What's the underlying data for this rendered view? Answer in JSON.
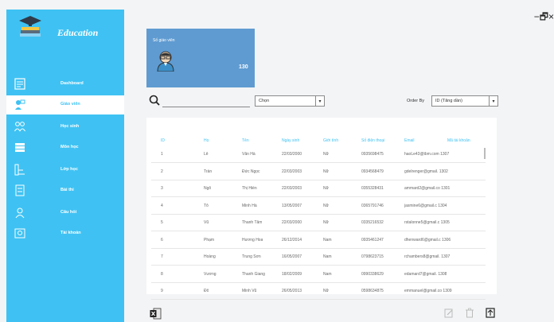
{
  "app": {
    "title": "Education"
  },
  "window_controls": {
    "label": "−🗗×"
  },
  "sidebar": {
    "items": [
      {
        "label": "Dashboard",
        "icon": "dashboard-icon",
        "active": false
      },
      {
        "label": "Giáo viên",
        "icon": "teacher-icon",
        "active": true
      },
      {
        "label": "Học sinh",
        "icon": "students-icon",
        "active": false
      },
      {
        "label": "Môn học",
        "icon": "subjects-icon",
        "active": false
      },
      {
        "label": "Lớp học",
        "icon": "classes-icon",
        "active": false
      },
      {
        "label": "Bài thi",
        "icon": "exam-icon",
        "active": false
      },
      {
        "label": "Câu hỏi",
        "icon": "questions-icon",
        "active": false
      },
      {
        "label": "Tài khoản",
        "icon": "account-icon",
        "active": false
      }
    ]
  },
  "summary": {
    "label": "Số giáo viên",
    "count": "130"
  },
  "search": {
    "value": "",
    "filter_value": "Chọn"
  },
  "order": {
    "label": "Order By",
    "value": "ID (Tăng dần)"
  },
  "table": {
    "columns": [
      "ID",
      "Họ",
      "Tên",
      "Ngày sinh",
      "Giới tính",
      "Số điện thoại",
      "Email",
      "Mã tài khoản"
    ],
    "rows": [
      [
        "1",
        "Lê",
        "Văn Hà",
        "22/03/2000",
        "Nữ",
        "0935698475",
        "haoLe43@tbm.com 1307",
        ""
      ],
      [
        "2",
        "Trần",
        "Đức Ngọc",
        "22/03/2003",
        "Nữ",
        "0934568479",
        "gdelrenger@gmail. 1302",
        ""
      ],
      [
        "3",
        "Ngô",
        "Thị Hiền",
        "22/03/2003",
        "Nữ",
        "0355328431",
        "ammard2@gmail.co 1301",
        ""
      ],
      [
        "4",
        "Tô",
        "Minh Hà",
        "13/05/2007",
        "Nữ",
        "0365791746",
        "jasmine6@gmail.c 1304",
        ""
      ],
      [
        "5",
        "Vũ",
        "Thanh Tâm",
        "22/03/2000",
        "Nữ",
        "0335216532",
        "rstalonne5@gmail.c 1305",
        ""
      ],
      [
        "6",
        "Phạm",
        "Hương Hoa",
        "26/12/2014",
        "Nam",
        "0935461247",
        "dhenward6@gmail.c 1306",
        ""
      ],
      [
        "7",
        "Hoàng",
        "Trung Sơn",
        "16/05/2007",
        "Nam",
        "0798623715",
        "rchambers8@gmail. 1307",
        ""
      ],
      [
        "8",
        "Vương",
        "Thanh Giang",
        "18/02/2009",
        "Nam",
        "0990338629",
        "edamard7@gmail. 1308",
        ""
      ],
      [
        "9",
        "Đỗ",
        "Minh Vũ",
        "26/05/2013",
        "Nữ",
        "0598634875",
        "emmanuel@gmail.co 1309",
        ""
      ]
    ]
  },
  "colors": {
    "sidebar": "#3fc2f3",
    "panel": "#5f9bd1",
    "accent": "#3fc2f3"
  }
}
